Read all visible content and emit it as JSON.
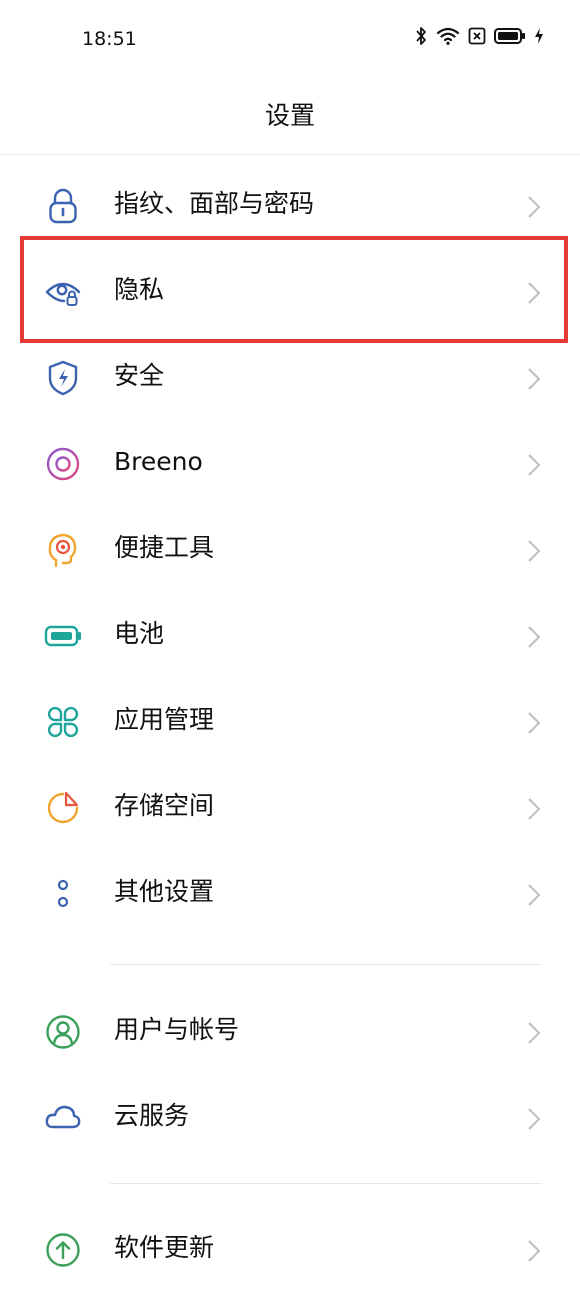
{
  "status_bar": {
    "time": "18:51",
    "icons": [
      "bluetooth-icon",
      "wifi-icon",
      "sim-off-icon",
      "battery-icon",
      "charging-icon"
    ]
  },
  "header": {
    "title": "设置"
  },
  "settings": [
    {
      "label": "指纹、面部与密码",
      "icon": "lock-icon",
      "color": "#3b63b0"
    },
    {
      "label": "隐私",
      "icon": "privacy-eye-icon",
      "color": "#3b63b0",
      "highlighted": true
    },
    {
      "label": "安全",
      "icon": "shield-icon",
      "color": "#3b63b0"
    },
    {
      "label": "Breeno",
      "icon": "breeno-icon",
      "color": "#d24f93"
    },
    {
      "label": "便捷工具",
      "icon": "head-target-icon",
      "color": "#f0a530"
    },
    {
      "label": "电池",
      "icon": "battery-setting-icon",
      "color": "#1fa59a"
    },
    {
      "label": "应用管理",
      "icon": "apps-grid-icon",
      "color": "#1fa59a"
    },
    {
      "label": "存储空间",
      "icon": "storage-pie-icon",
      "color": "#f0a530"
    },
    {
      "label": "其他设置",
      "icon": "more-dots-icon",
      "color": "#3b63b0"
    },
    {
      "label": "用户与帐号",
      "icon": "user-icon",
      "color": "#3aa05a"
    },
    {
      "label": "云服务",
      "icon": "cloud-icon",
      "color": "#3b63b0"
    },
    {
      "label": "软件更新",
      "icon": "update-arrow-icon",
      "color": "#3aa05a"
    }
  ],
  "annotation": {
    "color": "#e53935"
  }
}
